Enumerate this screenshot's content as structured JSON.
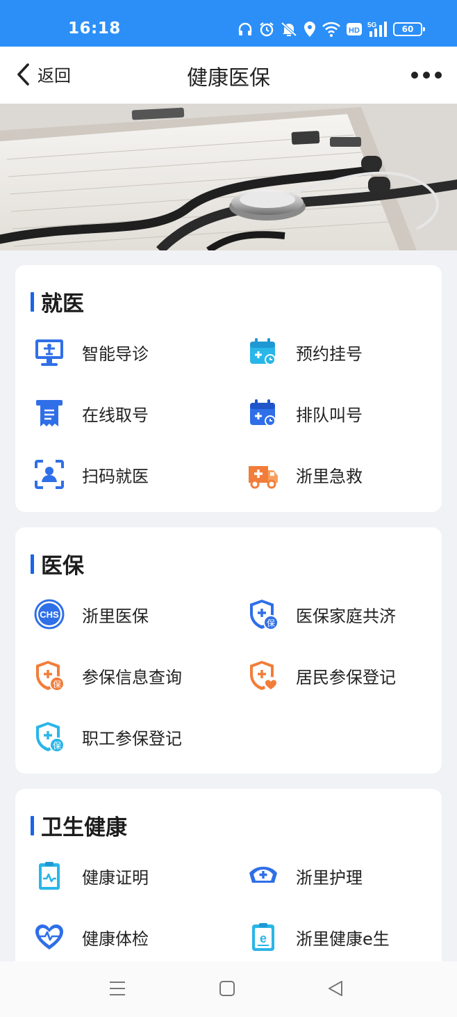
{
  "status_bar": {
    "time": "16:18",
    "icons": [
      "headphones-icon",
      "alarm-icon",
      "mute-icon",
      "location-icon",
      "wifi-icon",
      "hd-icon",
      "5g-signal-icon",
      "battery-icon"
    ],
    "hd_label": "HD",
    "net_label": "5G",
    "battery": "60"
  },
  "nav": {
    "back_label": "返回",
    "title": "健康医保"
  },
  "sections": [
    {
      "title": "就医",
      "items": [
        {
          "label": "智能导诊",
          "icon": "smart-guide-icon"
        },
        {
          "label": "预约挂号",
          "icon": "calendar-appointment-icon"
        },
        {
          "label": "在线取号",
          "icon": "ticket-icon"
        },
        {
          "label": "排队叫号",
          "icon": "queue-calendar-icon"
        },
        {
          "label": "扫码就医",
          "icon": "scan-user-icon"
        },
        {
          "label": "浙里急救",
          "icon": "ambulance-icon"
        }
      ]
    },
    {
      "title": "医保",
      "items": [
        {
          "label": "浙里医保",
          "icon": "chs-icon",
          "icon_text": "CHS"
        },
        {
          "label": "医保家庭共济",
          "icon": "shield-insurance-icon",
          "badge": "保"
        },
        {
          "label": "参保信息查询",
          "icon": "shield-insurance-icon",
          "badge": "保"
        },
        {
          "label": "居民参保登记",
          "icon": "shield-heart-icon"
        },
        {
          "label": "职工参保登记",
          "icon": "shield-insurance-icon",
          "badge": "保"
        }
      ]
    },
    {
      "title": "卫生健康",
      "items": [
        {
          "label": "健康证明",
          "icon": "health-certificate-icon"
        },
        {
          "label": "浙里护理",
          "icon": "nurse-cap-icon"
        },
        {
          "label": "健康体检",
          "icon": "heartbeat-icon"
        },
        {
          "label": "浙里健康e生",
          "icon": "e-record-icon",
          "icon_text": "e"
        }
      ]
    }
  ],
  "colors": {
    "status_bar": "#2b8ff7",
    "accent_blue": "#1766e6",
    "accent_orange": "#f27d3a",
    "accent_cyan": "#29b6e8"
  }
}
